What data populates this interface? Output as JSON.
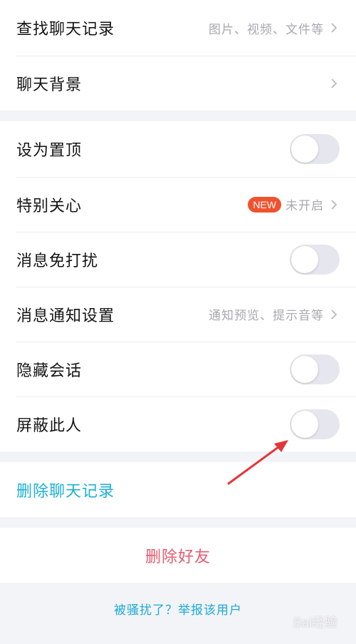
{
  "group1": {
    "search_history": {
      "label": "查找聊天记录",
      "hint": "图片、视频、文件等"
    },
    "chat_background": {
      "label": "聊天背景"
    }
  },
  "group2": {
    "pin_top": {
      "label": "设为置顶",
      "on": false
    },
    "special_care": {
      "label": "特别关心",
      "badge": "NEW",
      "status": "未开启"
    },
    "do_not_disturb": {
      "label": "消息免打扰",
      "on": false
    },
    "notify_settings": {
      "label": "消息通知设置",
      "hint": "通知预览、提示音等"
    },
    "hide_chat": {
      "label": "隐藏会话",
      "on": false
    },
    "block_user": {
      "label": "屏蔽此人",
      "on": false
    }
  },
  "actions": {
    "delete_chat_history": "删除聊天记录",
    "delete_friend": "删除好友",
    "report": "被骚扰了？举报该用户"
  },
  "watermark": "Bai经验",
  "colors": {
    "accent_blue": "#1bb0d8",
    "danger_red": "#e85a6e",
    "badge_red": "#f0522e",
    "arrow_red": "#e3363a"
  }
}
